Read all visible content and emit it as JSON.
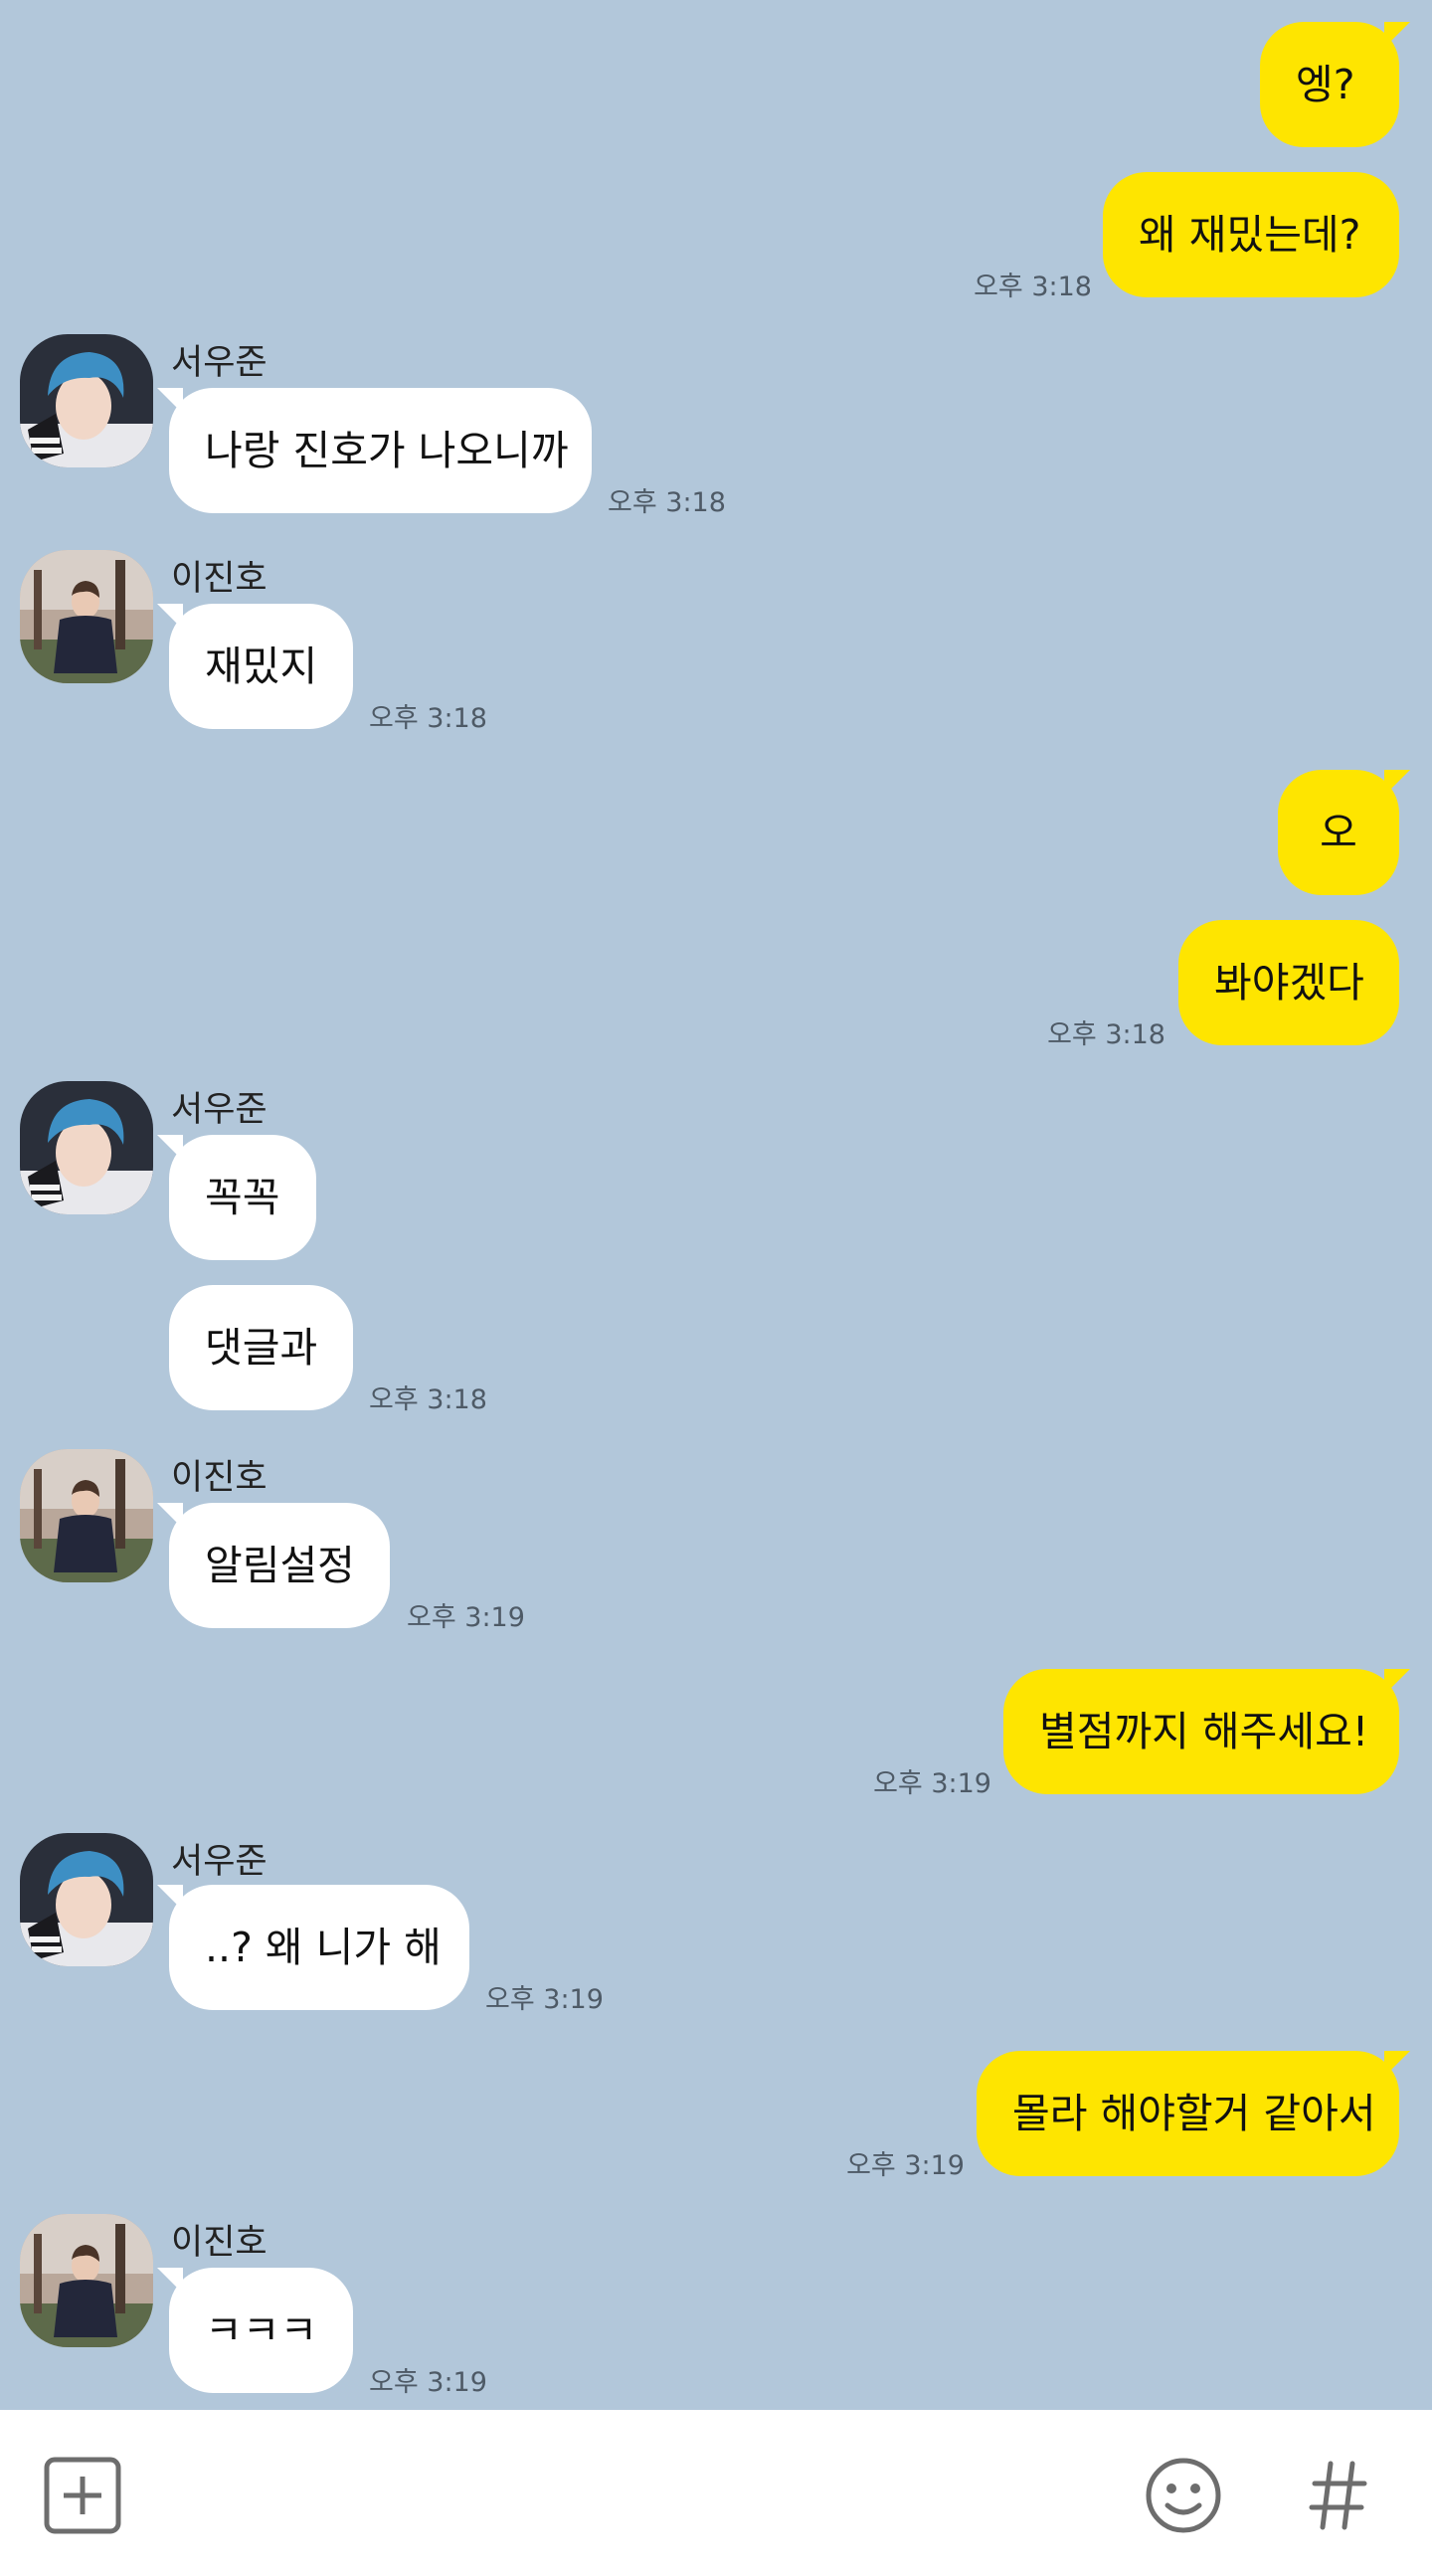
{
  "participants": {
    "woojun": {
      "name": "서우준",
      "avatar_icon": "avatar-blue-hair-person"
    },
    "jinho": {
      "name": "이진호",
      "avatar_icon": "avatar-person-in-park"
    }
  },
  "messages": [
    {
      "from": "me",
      "text": "엥?"
    },
    {
      "from": "me",
      "text": "왜 재밌는데?",
      "time": "오후 3:18"
    },
    {
      "from": "woojun",
      "sender": "서우준",
      "text": "나랑 진호가 나오니까",
      "time": "오후 3:18"
    },
    {
      "from": "jinho",
      "sender": "이진호",
      "text": "재밌지",
      "time": "오후 3:18"
    },
    {
      "from": "me",
      "text": "오"
    },
    {
      "from": "me",
      "text": "봐야겠다",
      "time": "오후 3:18"
    },
    {
      "from": "woojun",
      "sender": "서우준",
      "text": "꼭꼭"
    },
    {
      "from": "woojun",
      "text": "댓글과",
      "time": "오후 3:18"
    },
    {
      "from": "jinho",
      "sender": "이진호",
      "text": "알림설정",
      "time": "오후 3:19"
    },
    {
      "from": "me",
      "text": "별점까지 해주세요!",
      "time": "오후 3:19"
    },
    {
      "from": "woojun",
      "sender": "서우준",
      "text": "..? 왜 니가 해",
      "time": "오후 3:19"
    },
    {
      "from": "me",
      "text": "몰라 해야할거 같아서",
      "time": "오후 3:19"
    },
    {
      "from": "jinho",
      "sender": "이진호",
      "text": "ㅋㅋㅋ",
      "time": "오후 3:19"
    }
  ],
  "input_bar": {
    "left_icons": [
      "plus-icon"
    ],
    "right_icons": [
      "emoji-icon",
      "hashtag-icon"
    ]
  },
  "colors": {
    "background": "#b2c7da",
    "my_bubble": "#fee500",
    "other_bubble": "#ffffff",
    "time_text": "#4e5a66"
  }
}
